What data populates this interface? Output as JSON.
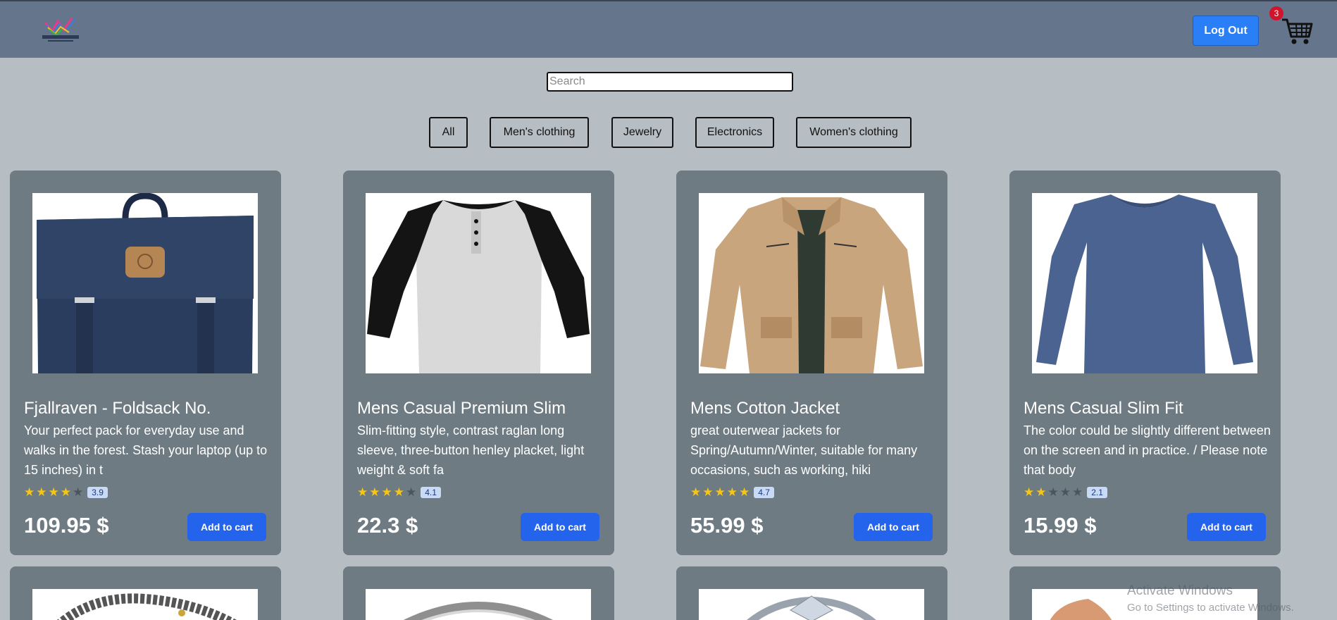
{
  "header": {
    "logout_label": "Log Out",
    "cart_count": "3"
  },
  "search": {
    "placeholder": "Search",
    "value": ""
  },
  "filters": [
    "All",
    "Men's clothing",
    "Jewelry",
    "Electronics",
    "Women's clothing"
  ],
  "products": [
    {
      "title": "Fjallraven - Foldsack No.",
      "description": "Your perfect pack for everyday use and walks in the forest. Stash your laptop (up to 15 inches) in t",
      "rating": "3.9",
      "stars": 4,
      "price": "109.95 $",
      "button": "Add to cart"
    },
    {
      "title": "Mens Casual Premium Slim",
      "description": "Slim-fitting style, contrast raglan long sleeve, three-button henley placket, light weight & soft fa",
      "rating": "4.1",
      "stars": 4,
      "price": "22.3 $",
      "button": "Add to cart"
    },
    {
      "title": "Mens Cotton Jacket",
      "description": "great outerwear jackets for Spring/Autumn/Winter, suitable for many occasions, such as working, hiki",
      "rating": "4.7",
      "stars": 5,
      "price": "55.99 $",
      "button": "Add to cart"
    },
    {
      "title": "Mens Casual Slim Fit",
      "description": "The color could be slightly different between on the screen and in practice. / Please note that body",
      "rating": "2.1",
      "stars": 2,
      "price": "15.99 $",
      "button": "Add to cart"
    }
  ],
  "watermark": {
    "line1": "Activate Windows",
    "line2": "Go to Settings to activate Windows."
  },
  "colors": {
    "header": "#65758b",
    "page": "#b7bec3",
    "card": "#6f7b83",
    "button": "#2463eb",
    "logout": "#2b7ff6",
    "badge": "#d0142c"
  }
}
